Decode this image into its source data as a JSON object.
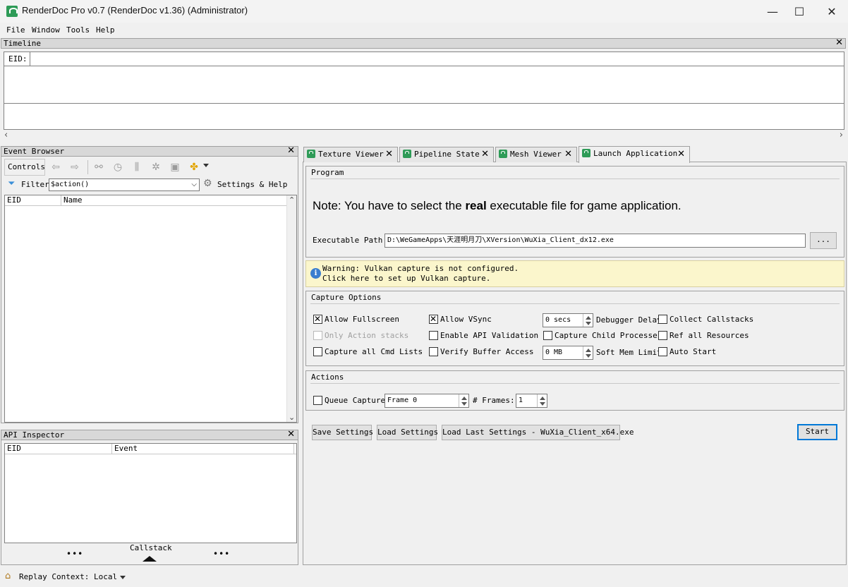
{
  "window": {
    "title": "RenderDoc Pro v0.7 (RenderDoc v1.36) (Administrator)",
    "minimize": "—",
    "maximize": "☐",
    "close": "✕"
  },
  "menu": [
    "File",
    "Window",
    "Tools",
    "Help"
  ],
  "timeline": {
    "title": "Timeline",
    "eid_label": "EID:"
  },
  "event_browser": {
    "title": "Event Browser",
    "controls_label": "Controls",
    "filter_label": "Filter",
    "filter_value": "$action()",
    "settings_label": "Settings & Help",
    "columns": [
      "EID",
      "Name"
    ]
  },
  "api_inspector": {
    "title": "API Inspector",
    "columns": [
      "EID",
      "Event"
    ],
    "callstack_label": "Callstack",
    "dots": "•••"
  },
  "status": {
    "replay_context": "Replay Context: Local"
  },
  "tabs": [
    {
      "label": "Texture Viewer"
    },
    {
      "label": "Pipeline State"
    },
    {
      "label": "Mesh Viewer"
    },
    {
      "label": "Launch Application"
    }
  ],
  "program": {
    "title": "Program",
    "note_prefix": "Note: You have to select the ",
    "note_bold": "real",
    "note_suffix": " executable file for game application.",
    "exe_label": "Executable Path",
    "exe_value": "D:\\WeGameApps\\天涯明月刀\\XVersion\\WuXia_Client_dx12.exe",
    "browse_label": "..."
  },
  "warning": {
    "line1": "Warning: Vulkan capture is not configured.",
    "line2": "Click here to set up Vulkan capture."
  },
  "capture_options": {
    "title": "Capture Options",
    "allow_fullscreen": "Allow Fullscreen",
    "only_action_stacks": "Only Action stacks",
    "capture_all_cmd": "Capture all Cmd Lists",
    "allow_vsync": "Allow VSync",
    "enable_api_validation": "Enable API Validation",
    "verify_buffer_access": "Verify Buffer Access",
    "debugger_delay_value": "0 secs",
    "debugger_delay_label": "Debugger Delay",
    "capture_child": "Capture Child Processes",
    "soft_mem_value": "0 MB",
    "soft_mem_label": "Soft Mem Limit",
    "collect_callstacks": "Collect Callstacks",
    "ref_all_resources": "Ref all Resources",
    "auto_start": "Auto Start"
  },
  "actions": {
    "title": "Actions",
    "queue_capture": "Queue Capture",
    "frame_value": "Frame 0",
    "frames_label": "# Frames:",
    "frames_value": "1"
  },
  "buttons": {
    "save_settings": "Save Settings",
    "load_settings": "Load Settings",
    "load_last": "Load Last Settings - WuXia_Client_x64.exe",
    "start": "Start"
  }
}
